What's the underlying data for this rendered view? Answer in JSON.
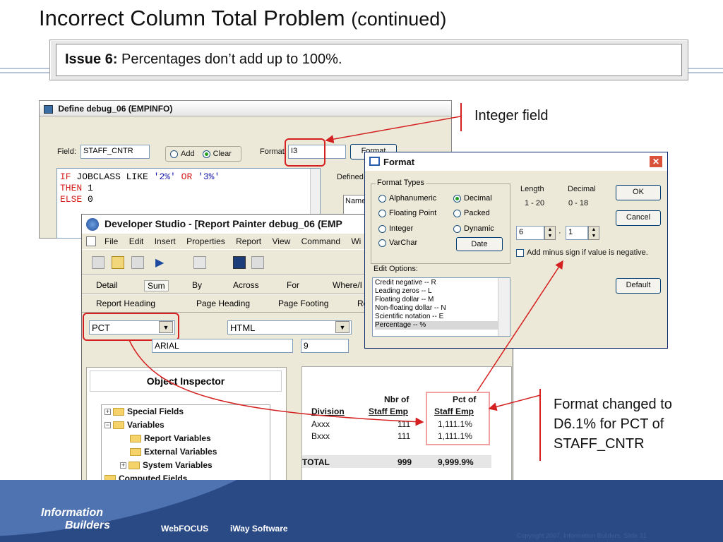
{
  "slide": {
    "title": "Incorrect Column Total Problem",
    "title_suffix": "(continued)",
    "issue_label": "Issue 6:",
    "issue_text": "Percentages don’t add up to 100%."
  },
  "define_window": {
    "title": "Define debug_06 (EMPINFO)",
    "field_label": "Field:",
    "field_value": "STAFF_CNTR",
    "radio_add": "Add",
    "radio_clear": "Clear",
    "format_label": "Format",
    "format_value": "I3",
    "format_button": "Format",
    "defined_label": "Defined",
    "name_col": "Name",
    "code": {
      "if": "IF",
      "line1_mid": " JOBCLASS LIKE ",
      "str1": "'2%'",
      "or": " OR ",
      "str2": "'3%'",
      "then": "THEN",
      "then_val": " 1",
      "else": "ELSE",
      "else_val": " 0"
    }
  },
  "dev_studio": {
    "title": "Developer Studio - [Report Painter debug_06 (EMP",
    "menu": [
      "File",
      "Edit",
      "Insert",
      "Properties",
      "Report",
      "View",
      "Command",
      "Wi"
    ],
    "toolbar2": [
      "Detail",
      "Sum",
      "By",
      "Across",
      "For",
      "Where/I"
    ],
    "toolbar3": [
      "Report Heading",
      "Page Heading",
      "Page Footing",
      "Re"
    ],
    "format_select": "PCT",
    "output_select": "HTML",
    "font_select": "ARIAL",
    "size_select": "9",
    "object_inspector": "Object Inspector",
    "tree": [
      "Special Fields",
      "Variables",
      "Report Variables",
      "External Variables",
      "System Variables",
      "Computed Fields"
    ]
  },
  "report": {
    "headers": {
      "division": "Division",
      "nbr1": "Nbr of",
      "nbr2": "Staff Emp",
      "pct1": "Pct of",
      "pct2": "Staff Emp"
    },
    "rows": [
      {
        "division": "Axxx",
        "nbr": "111",
        "pct": "1,111.1%"
      },
      {
        "division": "Bxxx",
        "nbr": "111",
        "pct": "1,111.1%"
      }
    ],
    "total": {
      "label": "TOTAL",
      "nbr": "999",
      "pct": "9,999.9%"
    }
  },
  "format_dialog": {
    "title": "Format",
    "types_label": "Format Types",
    "types": [
      "Alphanumeric",
      "Decimal",
      "Floating Point",
      "Packed",
      "Integer",
      "Dynamic",
      "VarChar"
    ],
    "date_button": "Date",
    "length_label": "Length",
    "length_range": "1 - 20",
    "decimal_label": "Decimal",
    "decimal_range": "0 - 18",
    "length_value": "6",
    "decimal_value": "1",
    "dot": "·",
    "minus_sign": "Add minus sign if value is negative.",
    "ok": "OK",
    "cancel": "Cancel",
    "default": "Default",
    "edit_label": "Edit Options:",
    "edit_options": [
      "Credit negative  -- R",
      "Leading zeros -- L",
      "Floating dollar -- M",
      "Non-floating dollar -- N",
      "Scientific notation -- E",
      "Percentage -- %"
    ]
  },
  "callouts": {
    "integer": "Integer field",
    "format_changed_1": "Format changed to",
    "format_changed_2": "D6.1% for PCT of",
    "format_changed_3": "STAFF_CNTR"
  },
  "footer": {
    "logo_1": "Information",
    "logo_2": "Builders",
    "webfocus": "WebFOCUS",
    "iway": "iWay Software",
    "copyright": "Copyright 2007, Information Builders. Slide 31"
  },
  "colors": {
    "highlight": "#d42020",
    "keyword": "#d41c1c",
    "string": "#1a1aa8"
  }
}
